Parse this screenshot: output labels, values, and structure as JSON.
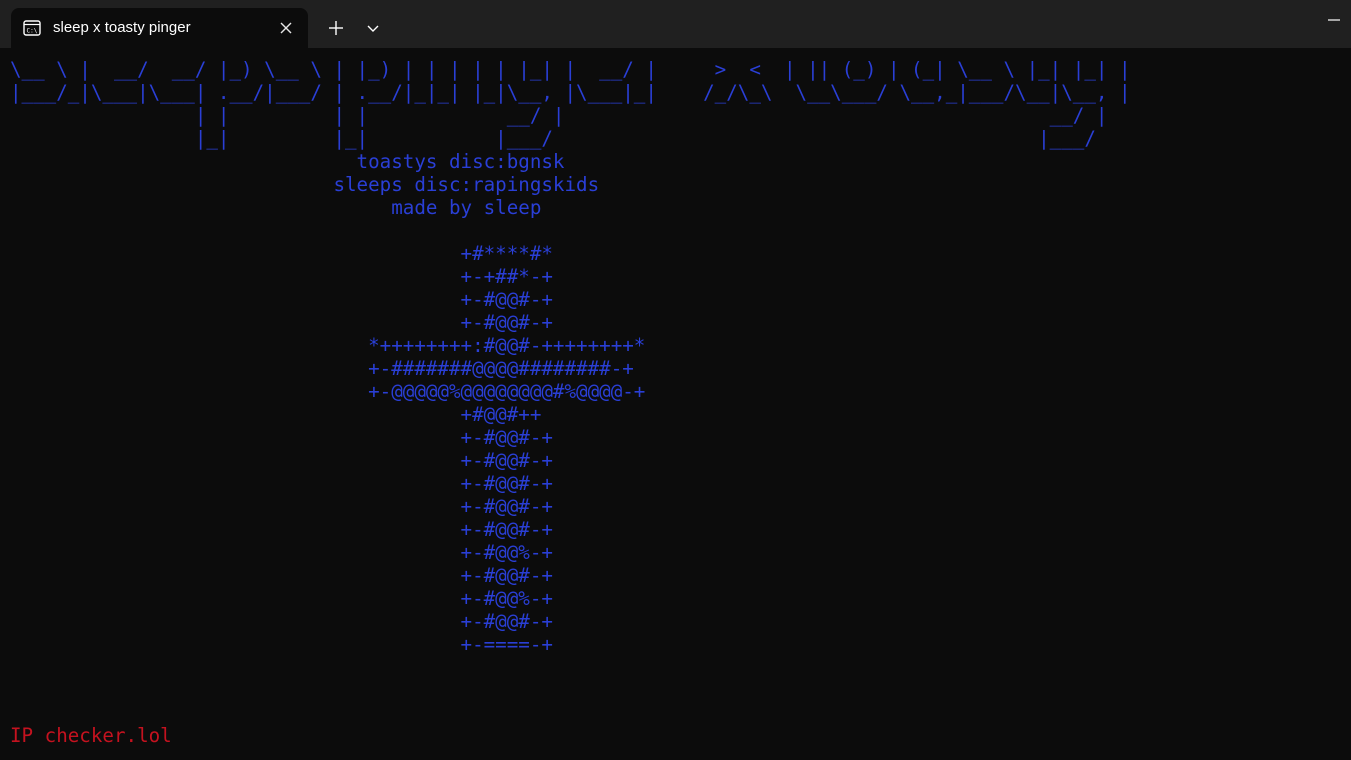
{
  "tab": {
    "title": "sleep x toasty pinger",
    "icon": "terminal-icon"
  },
  "titlebar": {
    "new_tab_icon": "plus-icon",
    "dropdown_icon": "chevron-down-icon",
    "minimize_icon": "minimize-icon",
    "close_icon": "close-icon"
  },
  "colors": {
    "banner": "#2a3fd6",
    "status": "#c5121f",
    "background": "#0c0c0c",
    "titlebar": "#202020"
  },
  "console": {
    "banner_lines": [
      "\\__ \\ |  __/  __/ |_) \\__ \\ | |_) | | | | | |_| |  __/ |     >  <  | || (_) | (_| \\__ \\ |_| |_| |",
      "|___/_|\\___|\\___| .__/|___/ | .__/|_|_| |_|\\__, |\\___|_|    /_/\\_\\  \\__\\___/ \\__,_|___/\\__|\\__, |",
      "                | |         | |            __/ |                                          __/ |",
      "                |_|         |_|           |___/                                          |___/",
      "                              toastys disc:bgnsk",
      "                            sleeps disc:rapingskids",
      "                                 made by sleep",
      "",
      "                                       +#****#*",
      "                                       +-+##*-+",
      "                                       +-#@@#-+",
      "                                       +-#@@#-+",
      "                               *++++++++:#@@#-++++++++*",
      "                               +-#######@@@@########-+",
      "                               +-@@@@@%@@@@@@@@#%@@@@-+",
      "                                       +#@@#++",
      "                                       +-#@@#-+",
      "                                       +-#@@#-+",
      "                                       +-#@@#-+",
      "                                       +-#@@#-+",
      "                                       +-#@@#-+",
      "                                       +-#@@%-+",
      "                                       +-#@@#-+",
      "                                       +-#@@%-+",
      "                                       +-#@@#-+",
      "                                       +-====-+"
    ],
    "status_line": "IP checker.lol"
  }
}
